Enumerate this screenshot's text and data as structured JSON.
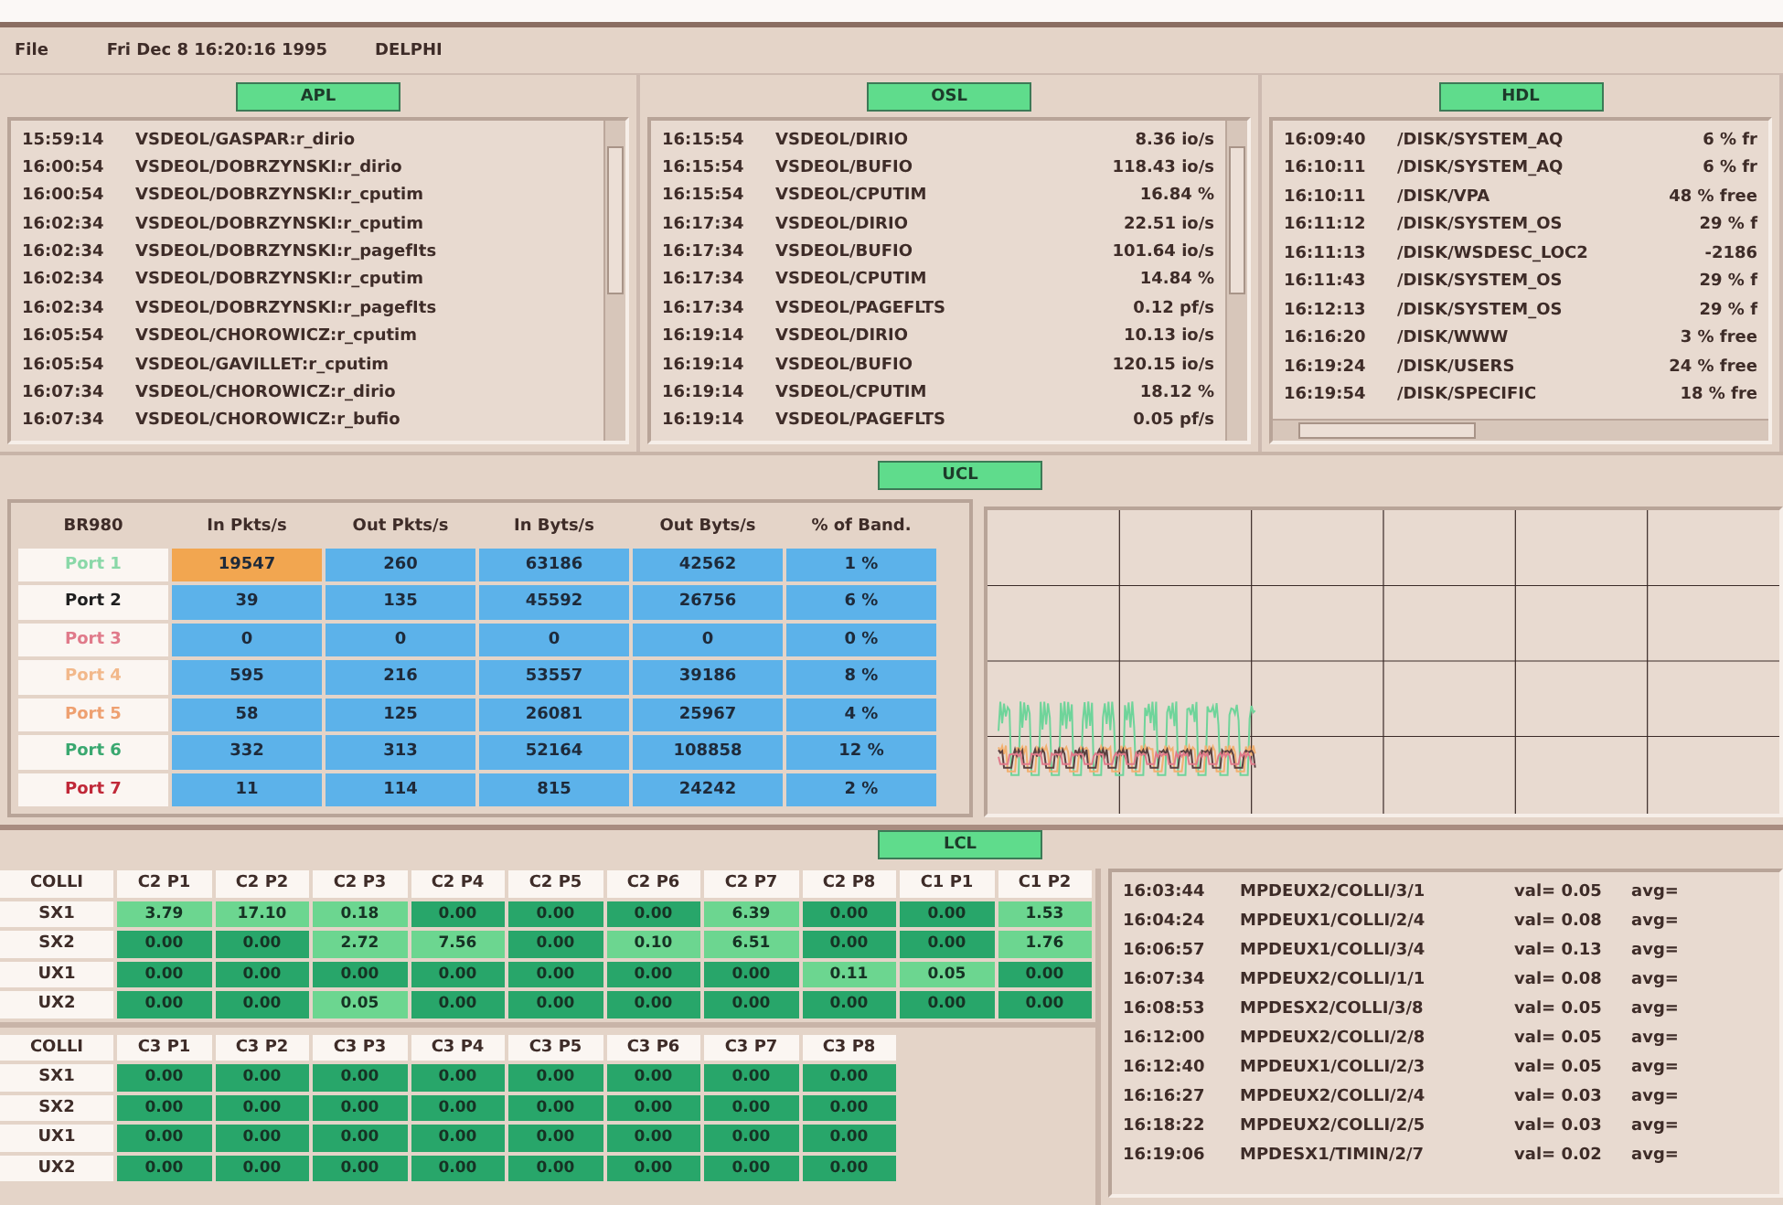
{
  "menu_bar": {
    "menu": "File",
    "datetime": "Fri Dec 8 16:20:16 1995",
    "host": "DELPHI"
  },
  "panels": [
    {
      "label": "APL",
      "rows": [
        {
          "time": "15:59:14",
          "item": "VSDEOL/GASPAR:r_dirio"
        },
        {
          "time": "16:00:54",
          "item": "VSDEOL/DOBRZYNSKI:r_dirio"
        },
        {
          "time": "16:00:54",
          "item": "VSDEOL/DOBRZYNSKI:r_cputim"
        },
        {
          "time": "16:02:34",
          "item": "VSDEOL/DOBRZYNSKI:r_cputim"
        },
        {
          "time": "16:02:34",
          "item": "VSDEOL/DOBRZYNSKI:r_pagefIts"
        },
        {
          "time": "16:02:34",
          "item": "VSDEOL/DOBRZYNSKI:r_cputim"
        },
        {
          "time": "16:02:34",
          "item": "VSDEOL/DOBRZYNSKI:r_pagefIts"
        },
        {
          "time": "16:05:54",
          "item": "VSDEOL/CHOROWICZ:r_cputim"
        },
        {
          "time": "16:05:54",
          "item": "VSDEOL/GAVILLET:r_cputim"
        },
        {
          "time": "16:07:34",
          "item": "VSDEOL/CHOROWICZ:r_dirio"
        },
        {
          "time": "16:07:34",
          "item": "VSDEOL/CHOROWICZ:r_bufio"
        }
      ]
    },
    {
      "label": "OSL",
      "rows": [
        {
          "time": "16:15:54",
          "item": "VSDEOL/DIRIO",
          "value": "8.36 io/s"
        },
        {
          "time": "16:15:54",
          "item": "VSDEOL/BUFIO",
          "value": "118.43 io/s"
        },
        {
          "time": "16:15:54",
          "item": "VSDEOL/CPUTIM",
          "value": "16.84 %"
        },
        {
          "time": "16:17:34",
          "item": "VSDEOL/DIRIO",
          "value": "22.51 io/s"
        },
        {
          "time": "16:17:34",
          "item": "VSDEOL/BUFIO",
          "value": "101.64 io/s"
        },
        {
          "time": "16:17:34",
          "item": "VSDEOL/CPUTIM",
          "value": "14.84 %"
        },
        {
          "time": "16:17:34",
          "item": "VSDEOL/PAGEFLTS",
          "value": "0.12 pf/s"
        },
        {
          "time": "16:19:14",
          "item": "VSDEOL/DIRIO",
          "value": "10.13 io/s"
        },
        {
          "time": "16:19:14",
          "item": "VSDEOL/BUFIO",
          "value": "120.15 io/s"
        },
        {
          "time": "16:19:14",
          "item": "VSDEOL/CPUTIM",
          "value": "18.12 %"
        },
        {
          "time": "16:19:14",
          "item": "VSDEOL/PAGEFLTS",
          "value": "0.05 pf/s"
        }
      ]
    },
    {
      "label": "HDL",
      "rows": [
        {
          "time": "16:09:40",
          "item": "/DISK/SYSTEM_AQ",
          "value": "6 % fr"
        },
        {
          "time": "16:10:11",
          "item": "/DISK/SYSTEM_AQ",
          "value": "6 % fr"
        },
        {
          "time": "16:10:11",
          "item": "/DISK/VPA",
          "value": "48 % free"
        },
        {
          "time": "16:11:12",
          "item": "/DISK/SYSTEM_OS",
          "value": "29 % f"
        },
        {
          "time": "16:11:13",
          "item": "/DISK/WSDESC_LOC2",
          "value": "-2186"
        },
        {
          "time": "16:11:43",
          "item": "/DISK/SYSTEM_OS",
          "value": "29 % f"
        },
        {
          "time": "16:12:13",
          "item": "/DISK/SYSTEM_OS",
          "value": "29 % f"
        },
        {
          "time": "16:16:20",
          "item": "/DISK/WWW",
          "value": "3 % free"
        },
        {
          "time": "16:19:24",
          "item": "/DISK/USERS",
          "value": "24 % free"
        },
        {
          "time": "16:19:54",
          "item": "/DISK/SPECIFIC",
          "value": "18 % fre"
        }
      ]
    }
  ],
  "ucl": {
    "label": "UCL",
    "corner": "BR980",
    "columns": [
      "In Pkts/s",
      "Out Pkts/s",
      "In Byts/s",
      "Out Byts/s",
      "% of Band."
    ],
    "rows": [
      {
        "name": "Port 1",
        "color": "#8ad8a8",
        "cells": [
          {
            "text": "19547",
            "highlight": true
          },
          {
            "text": "260",
            "highlight": false
          },
          {
            "text": "63186",
            "highlight": false
          },
          {
            "text": "42562",
            "highlight": false
          },
          {
            "text": "1 %",
            "highlight": false
          }
        ]
      },
      {
        "name": "Port 2",
        "color": "#202020",
        "cells": [
          {
            "text": "39",
            "highlight": false
          },
          {
            "text": "135",
            "highlight": false
          },
          {
            "text": "45592",
            "highlight": false
          },
          {
            "text": "26756",
            "highlight": false
          },
          {
            "text": "6 %",
            "highlight": false
          }
        ]
      },
      {
        "name": "Port 3",
        "color": "#e07a8a",
        "cells": [
          {
            "text": "0",
            "highlight": false
          },
          {
            "text": "0",
            "highlight": false
          },
          {
            "text": "0",
            "highlight": false
          },
          {
            "text": "0",
            "highlight": false
          },
          {
            "text": "0 %",
            "highlight": false
          }
        ]
      },
      {
        "name": "Port 4",
        "color": "#f2b88a",
        "cells": [
          {
            "text": "595",
            "highlight": false
          },
          {
            "text": "216",
            "highlight": false
          },
          {
            "text": "53557",
            "highlight": false
          },
          {
            "text": "39186",
            "highlight": false
          },
          {
            "text": "8 %",
            "highlight": false
          }
        ]
      },
      {
        "name": "Port 5",
        "color": "#eea070",
        "cells": [
          {
            "text": "58",
            "highlight": false
          },
          {
            "text": "125",
            "highlight": false
          },
          {
            "text": "26081",
            "highlight": false
          },
          {
            "text": "25967",
            "highlight": false
          },
          {
            "text": "4 %",
            "highlight": false
          }
        ]
      },
      {
        "name": "Port 6",
        "color": "#3aa870",
        "cells": [
          {
            "text": "332",
            "highlight": false
          },
          {
            "text": "313",
            "highlight": false
          },
          {
            "text": "52164",
            "highlight": false
          },
          {
            "text": "108858",
            "highlight": false
          },
          {
            "text": "12 %",
            "highlight": false
          }
        ]
      },
      {
        "name": "Port 7",
        "color": "#c02838",
        "cells": [
          {
            "text": "11",
            "highlight": false
          },
          {
            "text": "114",
            "highlight": false
          },
          {
            "text": "815",
            "highlight": false
          },
          {
            "text": "24242",
            "highlight": false
          },
          {
            "text": "2 %",
            "highlight": false
          }
        ]
      }
    ]
  },
  "lcl": {
    "label": "LCL",
    "grids": [
      {
        "corner": "COLLI",
        "columns": [
          "C2 P1",
          "C2 P2",
          "C2 P3",
          "C2 P4",
          "C2 P5",
          "C2 P6",
          "C2 P7",
          "C2 P8",
          "C1 P1",
          "C1 P2"
        ],
        "rows": [
          {
            "name": "SX1",
            "cells": [
              {
                "text": "3.79",
                "highlight": true
              },
              {
                "text": "17.10",
                "highlight": true
              },
              {
                "text": "0.18",
                "highlight": true
              },
              {
                "text": "0.00",
                "highlight": false
              },
              {
                "text": "0.00",
                "highlight": false
              },
              {
                "text": "0.00",
                "highlight": false
              },
              {
                "text": "6.39",
                "highlight": true
              },
              {
                "text": "0.00",
                "highlight": false
              },
              {
                "text": "0.00",
                "highlight": false
              },
              {
                "text": "1.53",
                "highlight": true
              }
            ]
          },
          {
            "name": "SX2",
            "cells": [
              {
                "text": "0.00",
                "highlight": false
              },
              {
                "text": "0.00",
                "highlight": false
              },
              {
                "text": "2.72",
                "highlight": true
              },
              {
                "text": "7.56",
                "highlight": true
              },
              {
                "text": "0.00",
                "highlight": false
              },
              {
                "text": "0.10",
                "highlight": true
              },
              {
                "text": "6.51",
                "highlight": true
              },
              {
                "text": "0.00",
                "highlight": false
              },
              {
                "text": "0.00",
                "highlight": false
              },
              {
                "text": "1.76",
                "highlight": true
              }
            ]
          },
          {
            "name": "UX1",
            "cells": [
              {
                "text": "0.00",
                "highlight": false
              },
              {
                "text": "0.00",
                "highlight": false
              },
              {
                "text": "0.00",
                "highlight": false
              },
              {
                "text": "0.00",
                "highlight": false
              },
              {
                "text": "0.00",
                "highlight": false
              },
              {
                "text": "0.00",
                "highlight": false
              },
              {
                "text": "0.00",
                "highlight": false
              },
              {
                "text": "0.11",
                "highlight": true
              },
              {
                "text": "0.05",
                "highlight": true
              },
              {
                "text": "0.00",
                "highlight": false
              }
            ]
          },
          {
            "name": "UX2",
            "cells": [
              {
                "text": "0.00",
                "highlight": false
              },
              {
                "text": "0.00",
                "highlight": false
              },
              {
                "text": "0.05",
                "highlight": true
              },
              {
                "text": "0.00",
                "highlight": false
              },
              {
                "text": "0.00",
                "highlight": false
              },
              {
                "text": "0.00",
                "highlight": false
              },
              {
                "text": "0.00",
                "highlight": false
              },
              {
                "text": "0.00",
                "highlight": false
              },
              {
                "text": "0.00",
                "highlight": false
              },
              {
                "text": "0.00",
                "highlight": false
              }
            ]
          }
        ]
      },
      {
        "corner": "COLLI",
        "columns": [
          "C3 P1",
          "C3 P2",
          "C3 P3",
          "C3 P4",
          "C3 P5",
          "C3 P6",
          "C3 P7",
          "C3 P8"
        ],
        "rows": [
          {
            "name": "SX1",
            "cells": [
              {
                "text": "0.00",
                "highlight": false
              },
              {
                "text": "0.00",
                "highlight": false
              },
              {
                "text": "0.00",
                "highlight": false
              },
              {
                "text": "0.00",
                "highlight": false
              },
              {
                "text": "0.00",
                "highlight": false
              },
              {
                "text": "0.00",
                "highlight": false
              },
              {
                "text": "0.00",
                "highlight": false
              },
              {
                "text": "0.00",
                "highlight": false
              }
            ]
          },
          {
            "name": "SX2",
            "cells": [
              {
                "text": "0.00",
                "highlight": false
              },
              {
                "text": "0.00",
                "highlight": false
              },
              {
                "text": "0.00",
                "highlight": false
              },
              {
                "text": "0.00",
                "highlight": false
              },
              {
                "text": "0.00",
                "highlight": false
              },
              {
                "text": "0.00",
                "highlight": false
              },
              {
                "text": "0.00",
                "highlight": false
              },
              {
                "text": "0.00",
                "highlight": false
              }
            ]
          },
          {
            "name": "UX1",
            "cells": [
              {
                "text": "0.00",
                "highlight": false
              },
              {
                "text": "0.00",
                "highlight": false
              },
              {
                "text": "0.00",
                "highlight": false
              },
              {
                "text": "0.00",
                "highlight": false
              },
              {
                "text": "0.00",
                "highlight": false
              },
              {
                "text": "0.00",
                "highlight": false
              },
              {
                "text": "0.00",
                "highlight": false
              },
              {
                "text": "0.00",
                "highlight": false
              }
            ]
          },
          {
            "name": "UX2",
            "cells": [
              {
                "text": "0.00",
                "highlight": false
              },
              {
                "text": "0.00",
                "highlight": false
              },
              {
                "text": "0.00",
                "highlight": false
              },
              {
                "text": "0.00",
                "highlight": false
              },
              {
                "text": "0.00",
                "highlight": false
              },
              {
                "text": "0.00",
                "highlight": false
              },
              {
                "text": "0.00",
                "highlight": false
              },
              {
                "text": "0.00",
                "highlight": false
              }
            ]
          }
        ]
      }
    ],
    "log": [
      {
        "time": "16:03:44",
        "item": "MPDEUX2/COLLI/3/1",
        "val": "val= 0.05",
        "avg": "avg="
      },
      {
        "time": "16:04:24",
        "item": "MPDEUX1/COLLI/2/4",
        "val": "val= 0.08",
        "avg": "avg="
      },
      {
        "time": "16:06:57",
        "item": "MPDEUX1/COLLI/3/4",
        "val": "val= 0.13",
        "avg": "avg="
      },
      {
        "time": "16:07:34",
        "item": "MPDEUX2/COLLI/1/1",
        "val": "val= 0.08",
        "avg": "avg="
      },
      {
        "time": "16:08:53",
        "item": "MPDESX2/COLLI/3/8",
        "val": "val= 0.05",
        "avg": "avg="
      },
      {
        "time": "16:12:00",
        "item": "MPDEUX2/COLLI/2/8",
        "val": "val= 0.05",
        "avg": "avg="
      },
      {
        "time": "16:12:40",
        "item": "MPDEUX1/COLLI/2/3",
        "val": "val= 0.05",
        "avg": "avg="
      },
      {
        "time": "16:16:27",
        "item": "MPDEUX2/COLLI/2/4",
        "val": "val= 0.03",
        "avg": "avg="
      },
      {
        "time": "16:18:22",
        "item": "MPDEUX2/COLLI/2/5",
        "val": "val= 0.03",
        "avg": "avg="
      },
      {
        "time": "16:19:06",
        "item": "MPDESX1/TIMIN/2/7",
        "val": "val= 0.02",
        "avg": "avg="
      }
    ]
  }
}
